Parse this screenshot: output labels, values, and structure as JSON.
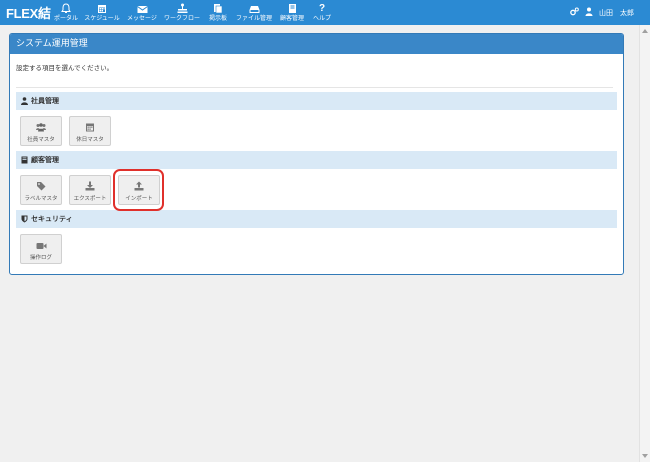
{
  "app": {
    "title": "FLEX結"
  },
  "nav": {
    "items": [
      {
        "label": "ポータル",
        "icon": "bell-icon"
      },
      {
        "label": "スケジュール",
        "icon": "calendar-icon"
      },
      {
        "label": "メッセージ",
        "icon": "envelope-icon"
      },
      {
        "label": "ワークフロー",
        "icon": "workflow-icon"
      },
      {
        "label": "掲示板",
        "icon": "board-icon"
      },
      {
        "label": "ファイル管理",
        "icon": "hdd-icon"
      },
      {
        "label": "顧客管理",
        "icon": "book-icon"
      },
      {
        "label": "ヘルプ",
        "icon": "question-icon"
      }
    ]
  },
  "user": {
    "name": "山田　太郎"
  },
  "panel": {
    "title": "システム運用管理",
    "description": "設定する項目を選んでください。"
  },
  "sections": [
    {
      "title": "社員管理",
      "icon": "user-icon",
      "tiles": [
        {
          "label": "社員マスタ",
          "icon": "users-icon"
        },
        {
          "label": "休日マスタ",
          "icon": "calendar-icon"
        }
      ]
    },
    {
      "title": "顧客管理",
      "icon": "book-icon",
      "tiles": [
        {
          "label": "ラベルマスタ",
          "icon": "tag-icon"
        },
        {
          "label": "エクスポート",
          "icon": "download-icon"
        },
        {
          "label": "インポート",
          "icon": "upload-icon"
        }
      ]
    },
    {
      "title": "セキュリティ",
      "icon": "shield-icon",
      "tiles": [
        {
          "label": "操作ログ",
          "icon": "video-camera-icon"
        }
      ]
    }
  ],
  "colors": {
    "nav_bg": "#2b8ad3",
    "panel_border": "#337ab7",
    "panel_header": "#3a87c8",
    "section_bg": "#d9e9f6",
    "highlight": "#e0302b"
  }
}
